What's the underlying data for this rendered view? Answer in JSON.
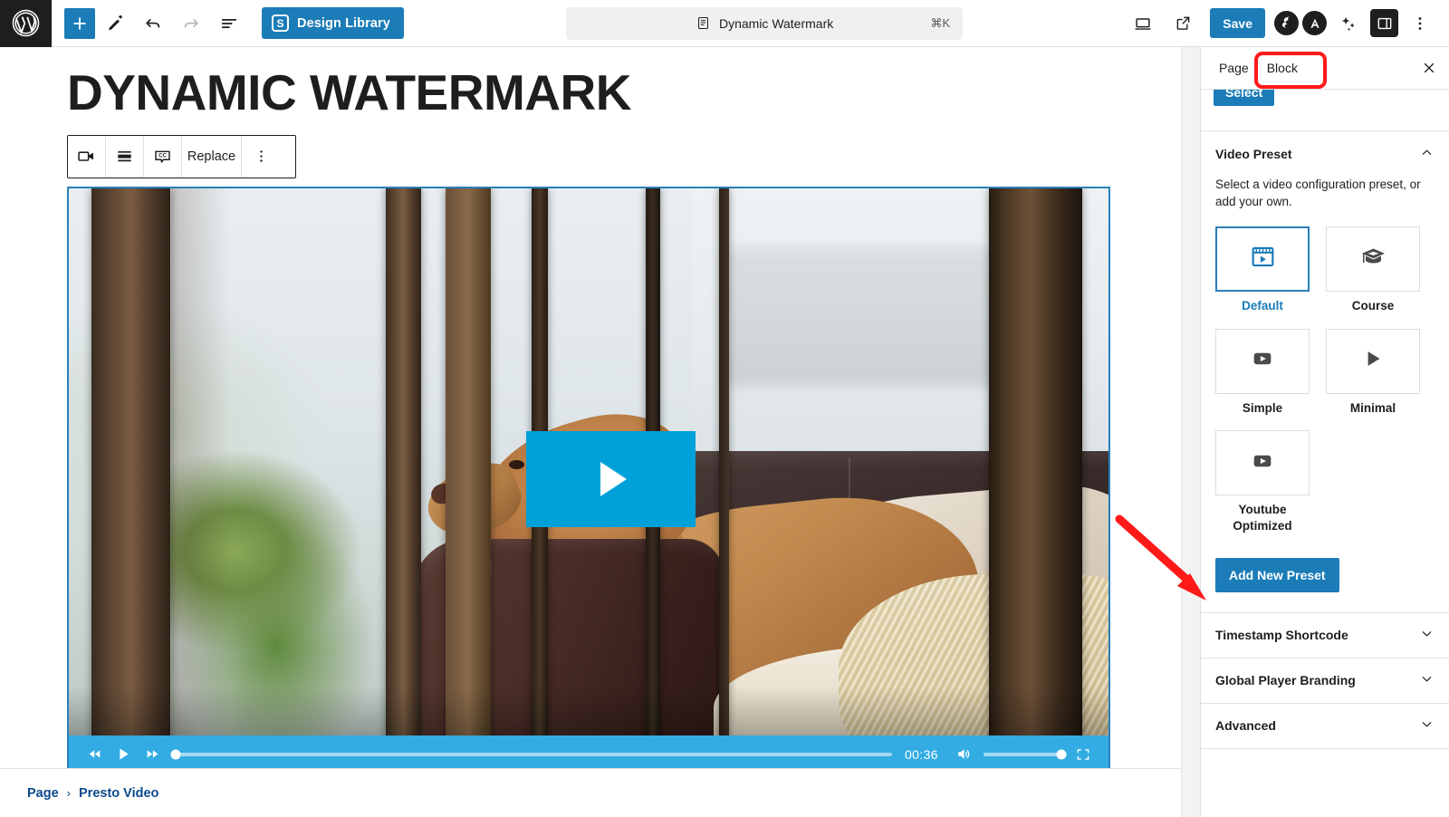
{
  "topbar": {
    "logo_icon": "wordpress-logo-icon",
    "add_block_label": "+",
    "tools_icon": "pencil-tools-icon",
    "undo_icon": "undo-icon",
    "redo_icon": "redo-icon",
    "list_view_icon": "document-overview-icon",
    "design_library_label": "Design Library",
    "design_library_badge": "S",
    "command_title": "Dynamic Watermark",
    "command_shortcut": "⌘K",
    "command_icon": "document-icon",
    "view_icon": "preview-desktop-icon",
    "external_icon": "view-external-icon",
    "save_label": "Save",
    "plugin_icon_1": "seedprod-bolt-icon",
    "plugin_icon_2": "aioseo-icon",
    "ai_icon": "sparkles-icon",
    "settings_panel_icon": "sidebar-toggle-icon",
    "options_icon": "more-options-icon"
  },
  "canvas": {
    "post_title": "DYNAMIC WATERMARK",
    "block_toolbar": {
      "video_icon": "video-camera-icon",
      "align_icon": "align-wide-icon",
      "captions_icon": "closed-captions-icon",
      "replace_label": "Replace",
      "more_icon": "more-options-icon"
    },
    "video": {
      "play_icon": "play-button-icon",
      "rewind_icon": "rewind-icon",
      "play_small_icon": "play-icon",
      "forward_icon": "fast-forward-icon",
      "time": "00:36",
      "volume_icon": "volume-high-icon",
      "fullscreen_icon": "fullscreen-icon",
      "progress_percent": 0,
      "volume_percent": 100,
      "accent_color": "#33ace3",
      "overlay_color": "#00a0d8"
    }
  },
  "breadcrumb": {
    "items": [
      {
        "label": "Page"
      },
      {
        "label": "Presto Video"
      }
    ],
    "separator": "›"
  },
  "sidebar": {
    "tabs": [
      {
        "label": "Page",
        "active": false
      },
      {
        "label": "Block",
        "active": true
      }
    ],
    "close_icon": "close-icon",
    "select_button_label": "Select",
    "video_preset": {
      "title": "Video Preset",
      "chevron_icon": "chevron-up-icon",
      "help_text": "Select a video configuration preset, or add your own.",
      "presets": [
        {
          "label": "Default",
          "icon": "film-play-icon",
          "selected": true
        },
        {
          "label": "Course",
          "icon": "graduation-cap-icon",
          "selected": false
        },
        {
          "label": "Simple",
          "icon": "play-box-filled-icon",
          "selected": false
        },
        {
          "label": "Minimal",
          "icon": "play-triangle-icon",
          "selected": false
        },
        {
          "label": "Youtube Optimized",
          "icon": "play-box-filled-icon",
          "selected": false
        }
      ],
      "add_button_label": "Add New Preset"
    },
    "panels": [
      {
        "label": "Timestamp Shortcode",
        "chevron_icon": "chevron-down-icon"
      },
      {
        "label": "Global Player Branding",
        "chevron_icon": "chevron-down-icon"
      },
      {
        "label": "Advanced",
        "chevron_icon": "chevron-down-icon"
      }
    ]
  },
  "annotations": {
    "highlight_color": "#ff1a1a",
    "rect_target": "Block tab",
    "arrow_target": "Add New Preset button"
  }
}
